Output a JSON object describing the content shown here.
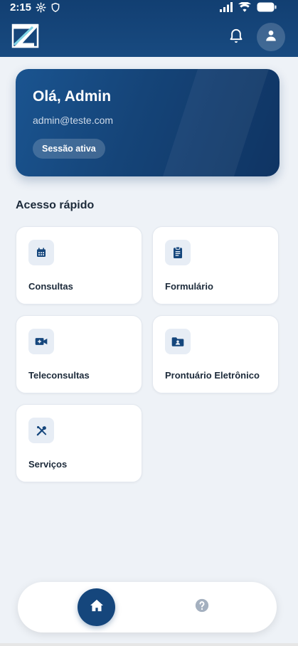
{
  "status_bar": {
    "time": "2:15",
    "left_icons": [
      "settings-gear-icon",
      "shield-icon"
    ],
    "right_icons": [
      "signal-icon",
      "wifi-icon",
      "battery-icon"
    ]
  },
  "header": {
    "logo_icon": "app-logo",
    "notification_icon": "bell-icon",
    "profile_icon": "user-icon"
  },
  "welcome": {
    "greeting": "Olá, Admin",
    "email": "admin@teste.com",
    "session_badge": "Sessão ativa"
  },
  "quick_access": {
    "title": "Acesso rápido",
    "items": [
      {
        "label": "Consultas",
        "icon": "calendar-icon"
      },
      {
        "label": "Formulário",
        "icon": "clipboard-icon"
      },
      {
        "label": "Teleconsultas",
        "icon": "video-call-icon"
      },
      {
        "label": "Prontuário Eletrônico",
        "icon": "folder-user-icon"
      },
      {
        "label": "Serviços",
        "icon": "tools-icon"
      }
    ]
  },
  "bottom_nav": {
    "home_icon": "home-icon",
    "help_icon": "help-icon"
  },
  "colors": {
    "primary": "#15467c",
    "header": "#123f72",
    "background": "#eef2f7",
    "tile_icon_bg": "#e7edf5"
  }
}
